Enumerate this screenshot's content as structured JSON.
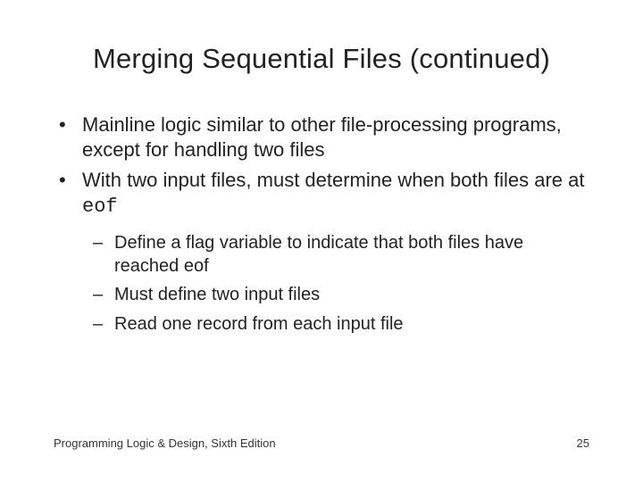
{
  "title": "Merging Sequential Files (continued)",
  "bullets": [
    {
      "text_before": "Mainline logic similar to other file-processing programs, except for handling two files",
      "code": "",
      "text_after": ""
    },
    {
      "text_before": "With two input files, must determine when both files are at ",
      "code": "eof",
      "text_after": ""
    }
  ],
  "sub_bullets": [
    "Define a flag variable to indicate that both files have reached eof",
    "Must define two input files",
    "Read one record from each input file"
  ],
  "footer_left": "Programming Logic & Design, Sixth Edition",
  "footer_right": "25"
}
